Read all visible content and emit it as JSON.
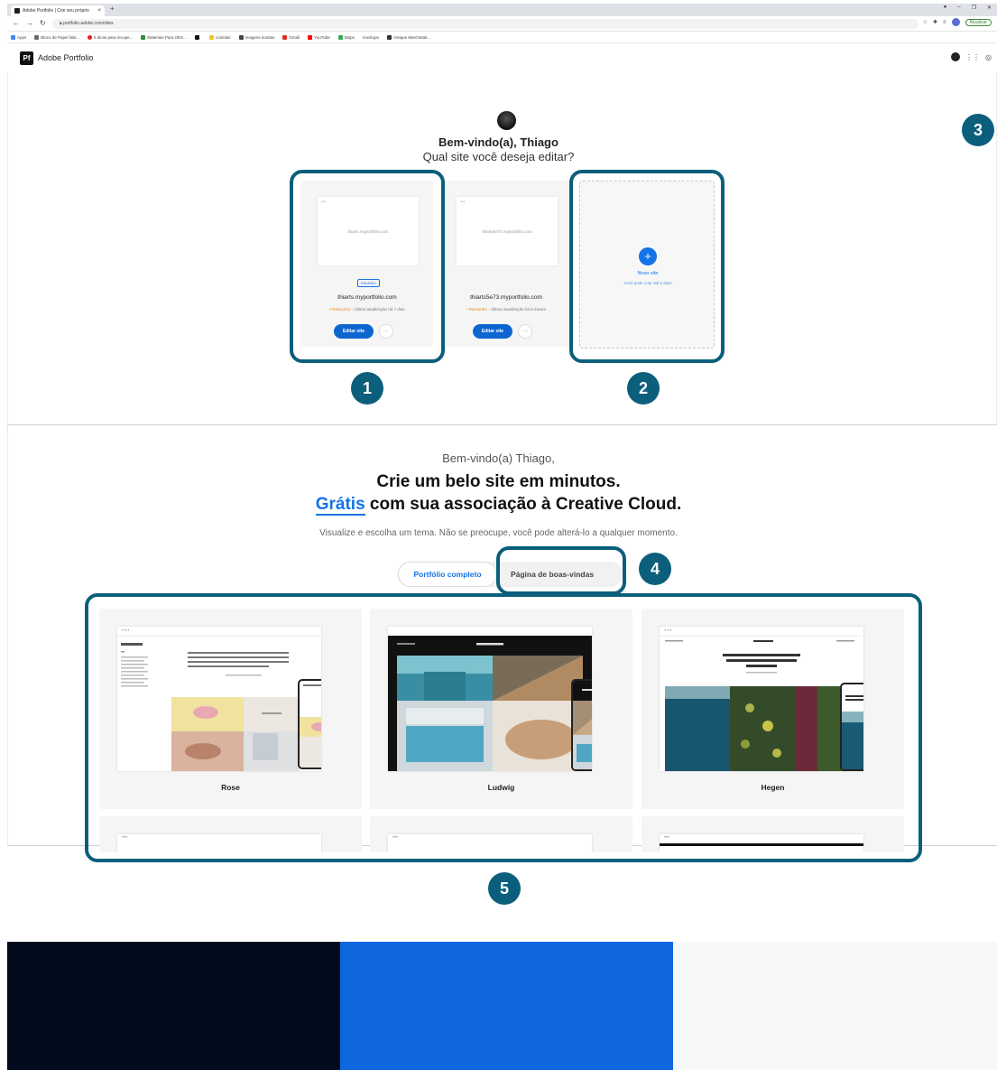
{
  "browser": {
    "tab_title": "Adobe Portfolio | Crie seu próprio",
    "tab_close": "×",
    "new_tab": "+",
    "url": "portfolio.adobe.com/sites",
    "update_label": "Atualizar",
    "bookmarks": [
      "Apps",
      "Bloco de Papel fabr...",
      "5 dicas para recupe...",
      "Materiais Para Otim...",
      "",
      "comidas",
      "imagens bonitas",
      "Gmail",
      "YouTube",
      "Maps",
      "mockups",
      "Antique Marchetati..."
    ]
  },
  "app": {
    "logo": "Pf",
    "name": "Adobe Portfolio"
  },
  "site_picker": {
    "welcome": "Bem-vindo(a), Thiago",
    "question": "Qual site você deseja editar?",
    "sites": [
      {
        "thumb_text": "thiarts.myportfolio.com",
        "badge": "PADRÃO",
        "domain": "thiarts.myportfolio.com",
        "status_dot": "•",
        "status_label": "Rascunho",
        "status_detail": " - Última atualização há 7 dias",
        "edit_label": "Editar site",
        "more_label": "···"
      },
      {
        "thumb_text": "thiarts5e73.myportfolio.com",
        "badge": "",
        "domain": "thiarts5e73.myportfolio.com",
        "status_dot": "•",
        "status_label": "Rascunho",
        "status_detail": " - Última atualização há 8 meses",
        "edit_label": "Editar site",
        "more_label": "···"
      }
    ],
    "new_site": {
      "icon": "+",
      "title": "Novo site",
      "subtitle": "Você pode criar até 5 sites"
    }
  },
  "themes_section": {
    "greeting": "Bem-vindo(a) Thiago,",
    "title_line1": "Crie um belo site em minutos.",
    "title_free": "Grátis",
    "title_line2_rest": " com sua associação à Creative Cloud.",
    "subtitle": "Visualize e escolha um tema. Não se preocupe, você pode alterá-lo a qualquer momento.",
    "tab_full": "Portfólio completo",
    "tab_welcome": "Página de boas-vindas",
    "themes": [
      {
        "name": "Rose"
      },
      {
        "name": "Ludwig"
      },
      {
        "name": "Hegen"
      }
    ]
  },
  "annotations": [
    "1",
    "2",
    "3",
    "4",
    "5"
  ],
  "palette": [
    "#020b1c",
    "#0f67df",
    "#f7f8fa"
  ],
  "colors": {
    "annotation": "#0b5f7c",
    "accent": "#1473e6",
    "draft": "#e68619"
  }
}
